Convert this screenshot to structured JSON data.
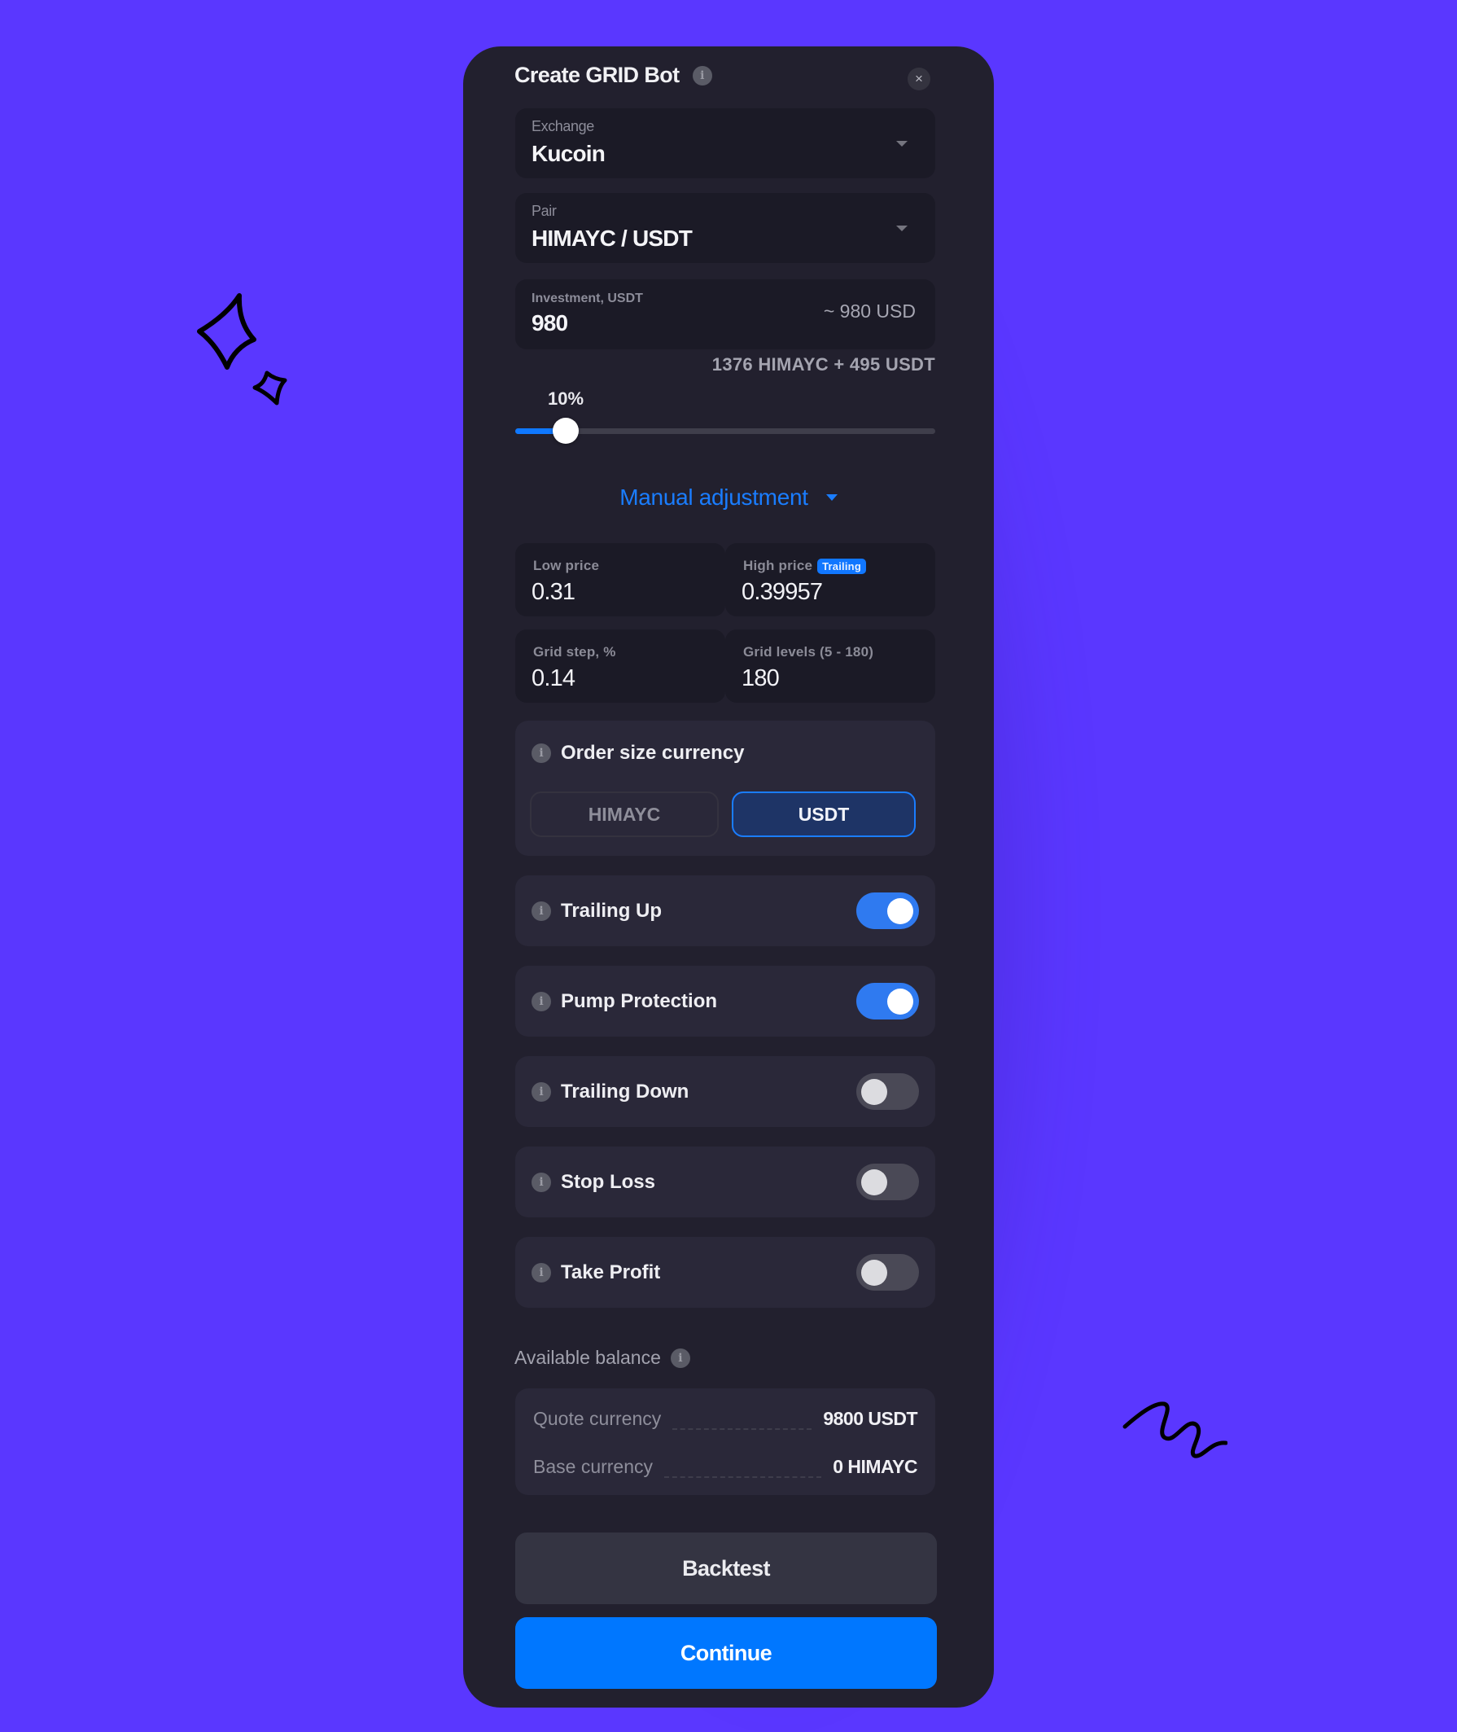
{
  "dialog": {
    "title": "Create GRID Bot",
    "close_icon": "×"
  },
  "exchange": {
    "label": "Exchange",
    "value": "Kucoin"
  },
  "pair": {
    "label": "Pair",
    "value": "HIMAYC / USDT"
  },
  "investment": {
    "label": "Investment, USDT",
    "value": "980",
    "usd_estimate": "~ 980 USD",
    "split": "1376 HIMAYC + 495 USDT"
  },
  "slider": {
    "label": "10%",
    "value_percent": 10
  },
  "manual_adjustment": {
    "label": "Manual adjustment"
  },
  "grid": {
    "low_price": {
      "label": "Low price",
      "value": "0.31"
    },
    "high_price": {
      "label": "High price",
      "badge": "Trailing",
      "value": "0.39957"
    },
    "grid_step": {
      "label": "Grid step, %",
      "value": "0.14"
    },
    "grid_levels": {
      "label": "Grid levels (5 - 180)",
      "value": "180"
    }
  },
  "order_size_currency": {
    "label": "Order size currency",
    "options": [
      "HIMAYC",
      "USDT"
    ],
    "selected": "USDT"
  },
  "toggles": [
    {
      "label": "Trailing Up",
      "on": true
    },
    {
      "label": "Pump Protection",
      "on": true
    },
    {
      "label": "Trailing Down",
      "on": false
    },
    {
      "label": "Stop Loss",
      "on": false
    },
    {
      "label": "Take Profit",
      "on": false
    }
  ],
  "balance": {
    "label": "Available balance",
    "rows": [
      {
        "key": "Quote currency",
        "value": "9800 USDT"
      },
      {
        "key": "Base currency",
        "value": "0 HIMAYC"
      }
    ]
  },
  "buttons": {
    "backtest": "Backtest",
    "continue": "Continue"
  },
  "colors": {
    "background": "#5a37ff",
    "card": "#22202e",
    "accent": "#0077ff",
    "toggle_on": "#2f7af0"
  },
  "icons": {
    "info": "i"
  }
}
